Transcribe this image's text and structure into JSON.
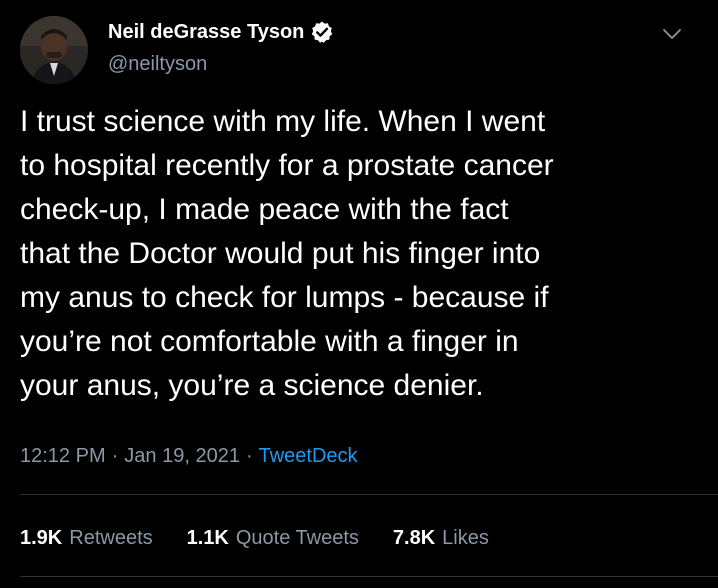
{
  "author": {
    "name": "Neil deGrasse Tyson",
    "handle": "@neiltyson",
    "verified": true
  },
  "tweet": {
    "lines": [
      "I trust science with my life. When I went",
      "to hospital recently for a prostate cancer",
      "check-up, I made peace with the fact",
      "that the Doctor would put his finger into",
      "my anus to check for lumps - because if",
      "you’re not comfortable with a finger in",
      "your anus, you’re a science denier."
    ],
    "time": "12:12 PM",
    "separator": "·",
    "date": "Jan 19, 2021",
    "source": "TweetDeck"
  },
  "stats": {
    "retweets": {
      "count": "1.9K",
      "label": "Retweets"
    },
    "quote_tweets": {
      "count": "1.1K",
      "label": "Quote Tweets"
    },
    "likes": {
      "count": "7.8K",
      "label": "Likes"
    }
  },
  "colors": {
    "background": "#000000",
    "primary_text": "#ffffff",
    "secondary_text": "#8b98a5",
    "link": "#1d9bf0",
    "divider": "#2f3336"
  }
}
